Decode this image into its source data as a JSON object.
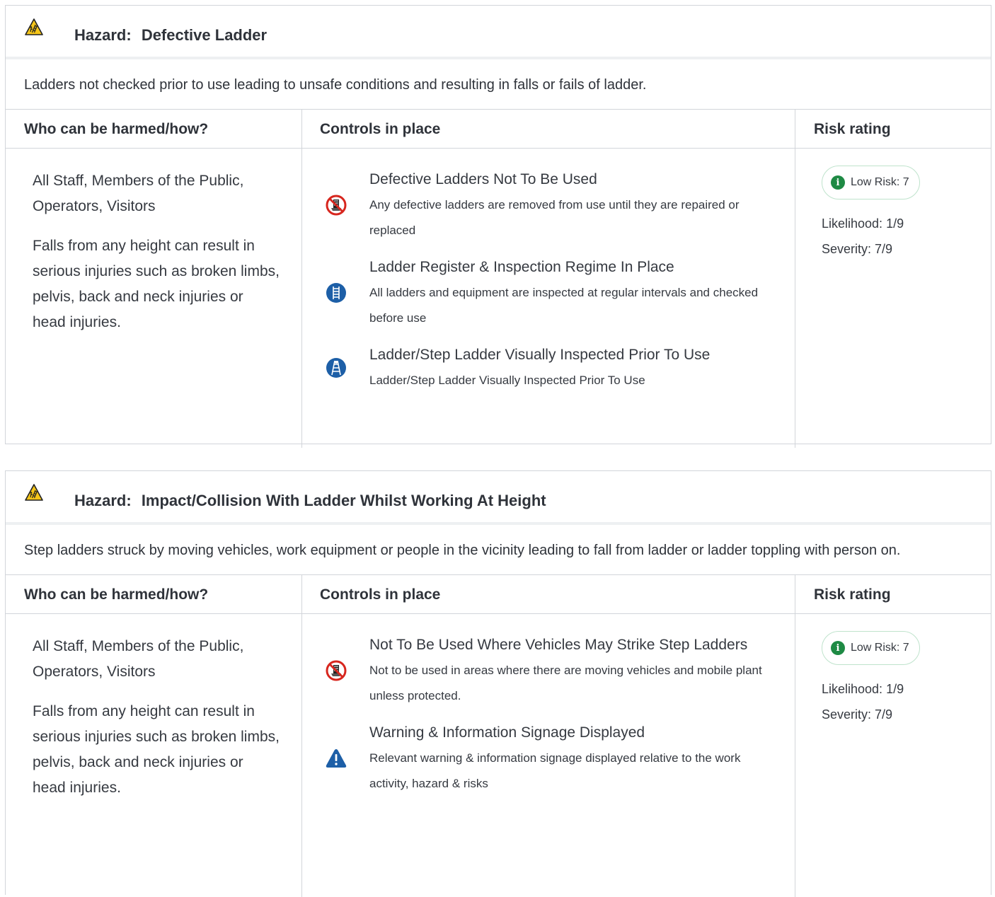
{
  "colors": {
    "low_risk": "#1e8a44",
    "mandatory_blue": "#1d5fa7",
    "prohibition_red": "#d7261e",
    "warning_yellow": "#f5c518"
  },
  "hazards": [
    {
      "icon": "ladder-hazard-warning-icon",
      "title_prefix": "Hazard:",
      "title": "Defective Ladder",
      "description": "Ladders not checked prior to use leading to unsafe conditions and resulting in falls or fails of ladder.",
      "headers": {
        "who": "Who can be harmed/how?",
        "controls": "Controls in place",
        "risk": "Risk rating"
      },
      "who": "All Staff, Members of the Public, Operators, Visitors",
      "how": "Falls from any height can result in serious injuries such as broken limbs, pelvis, back and neck injuries or head injuries.",
      "controls": [
        {
          "icon": "no-ladder-prohibition-icon",
          "title": "Defective Ladders Not To Be Used",
          "desc": "Any defective ladders are removed from use until they are repaired or replaced"
        },
        {
          "icon": "ladder-mandatory-icon",
          "title": "Ladder Register & Inspection Regime In Place",
          "desc": "All ladders and equipment are inspected at regular intervals and checked before use"
        },
        {
          "icon": "step-ladder-mandatory-icon",
          "title": "Ladder/Step Ladder Visually Inspected Prior To Use",
          "desc": "Ladder/Step Ladder Visually Inspected Prior To Use"
        }
      ],
      "risk": {
        "label": "Low Risk: 7",
        "likelihood": "Likelihood: 1/9",
        "severity": "Severity: 7/9"
      }
    },
    {
      "icon": "ladder-hazard-warning-icon",
      "title_prefix": "Hazard:",
      "title": "Impact/Collision With Ladder Whilst Working At Height",
      "description": "Step ladders struck by moving vehicles, work equipment or people in the vicinity leading to fall from ladder or ladder toppling with person on.",
      "headers": {
        "who": "Who can be harmed/how?",
        "controls": "Controls in place",
        "risk": "Risk rating"
      },
      "who": "All Staff, Members of the Public, Operators, Visitors",
      "how": "Falls from any height can result in serious injuries such as broken limbs, pelvis, back and neck injuries or head injuries.",
      "controls": [
        {
          "icon": "no-ladder-prohibition-icon",
          "title": "Not To Be Used Where Vehicles May Strike Step Ladders",
          "desc": "Not to be used in areas where there are moving vehicles and mobile plant unless protected."
        },
        {
          "icon": "warning-triangle-icon",
          "title": "Warning & Information Signage Displayed",
          "desc": "Relevant warning & information signage displayed relative to the work activity, hazard & risks"
        }
      ],
      "risk": {
        "label": "Low Risk: 7",
        "likelihood": "Likelihood: 1/9",
        "severity": "Severity: 7/9"
      }
    }
  ]
}
